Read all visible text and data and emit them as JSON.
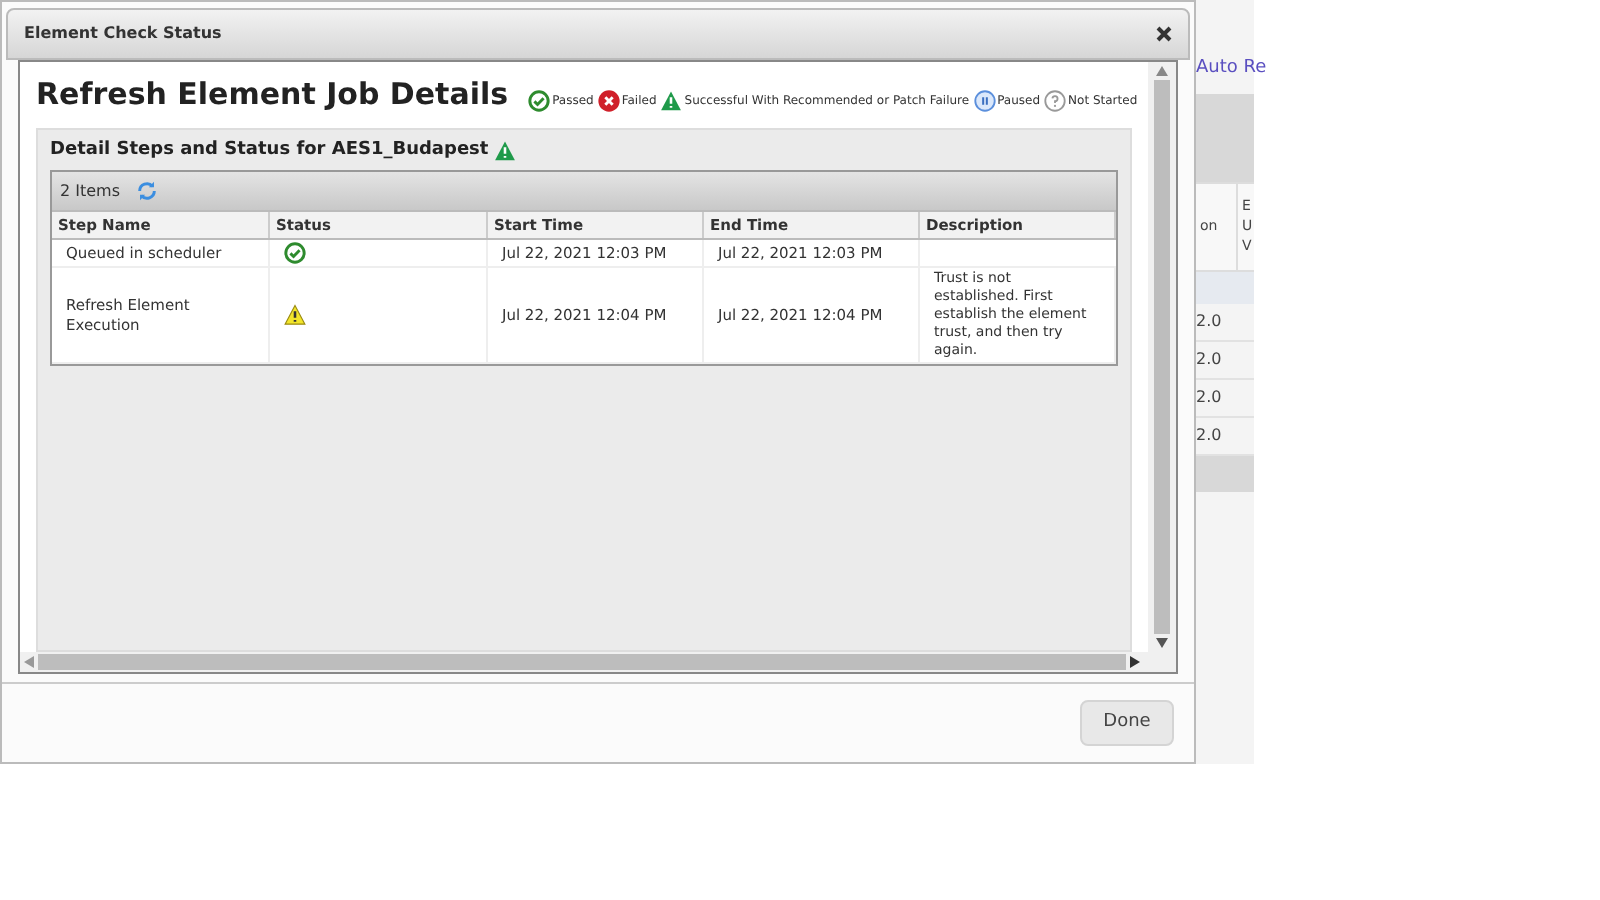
{
  "dialog": {
    "title": "Element Check Status",
    "heading": "Refresh Element Job Details",
    "legend": [
      {
        "kind": "passed",
        "label": "Passed"
      },
      {
        "kind": "failed",
        "label": "Failed"
      },
      {
        "kind": "warning",
        "label": "Successful With Recommended or Patch Failure"
      },
      {
        "kind": "paused",
        "label": "Paused"
      },
      {
        "kind": "not_started",
        "label": "Not Started"
      }
    ],
    "section": {
      "title": "Detail Steps and Status for AES1_Budapest",
      "kind": "warning"
    },
    "item_count": "2 Items",
    "table": {
      "columns": [
        "Step Name",
        "Status",
        "Start Time",
        "End Time",
        "Description"
      ],
      "rows": [
        {
          "step": "Queued in scheduler",
          "kind": "passed",
          "start": "Jul 22, 2021 12:03 PM",
          "end": "Jul 22, 2021 12:03 PM"
        },
        {
          "step": "Refresh Element Execution",
          "kind": "warning",
          "start": "Jul 22, 2021 12:04 PM",
          "end": "Jul 22, 2021 12:04 PM",
          "description": "Trust is not established. First establish the element trust, and then try again."
        }
      ]
    },
    "done_button": "Done"
  },
  "background": {
    "link": "Auto Re",
    "columns": [
      "on",
      "E\nU\nV"
    ],
    "rows": [
      "2.0",
      "2.0",
      "2.0",
      "2.0"
    ]
  }
}
